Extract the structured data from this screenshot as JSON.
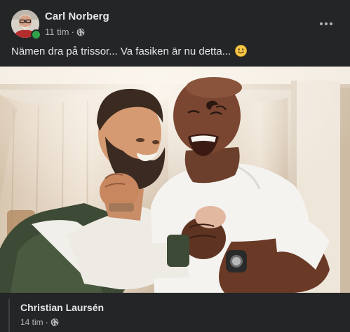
{
  "post": {
    "author": "Carl Norberg",
    "time": "11 tim",
    "separator": "·",
    "privacy_icon": "globe-icon",
    "more_icon": "more-horizontal-icon",
    "text": "Nämen dra på trissor... Va fasiken är nu detta...",
    "emoji": "slightly-smiling-face",
    "online": true
  },
  "comment": {
    "author": "Christian Laursén",
    "time": "14 tim",
    "separator": "·",
    "privacy_icon": "globe-icon"
  },
  "colors": {
    "card_bg": "#242526",
    "text_primary": "#e4e6eb",
    "text_secondary": "#b0b3b8",
    "online_green": "#31a24c"
  }
}
